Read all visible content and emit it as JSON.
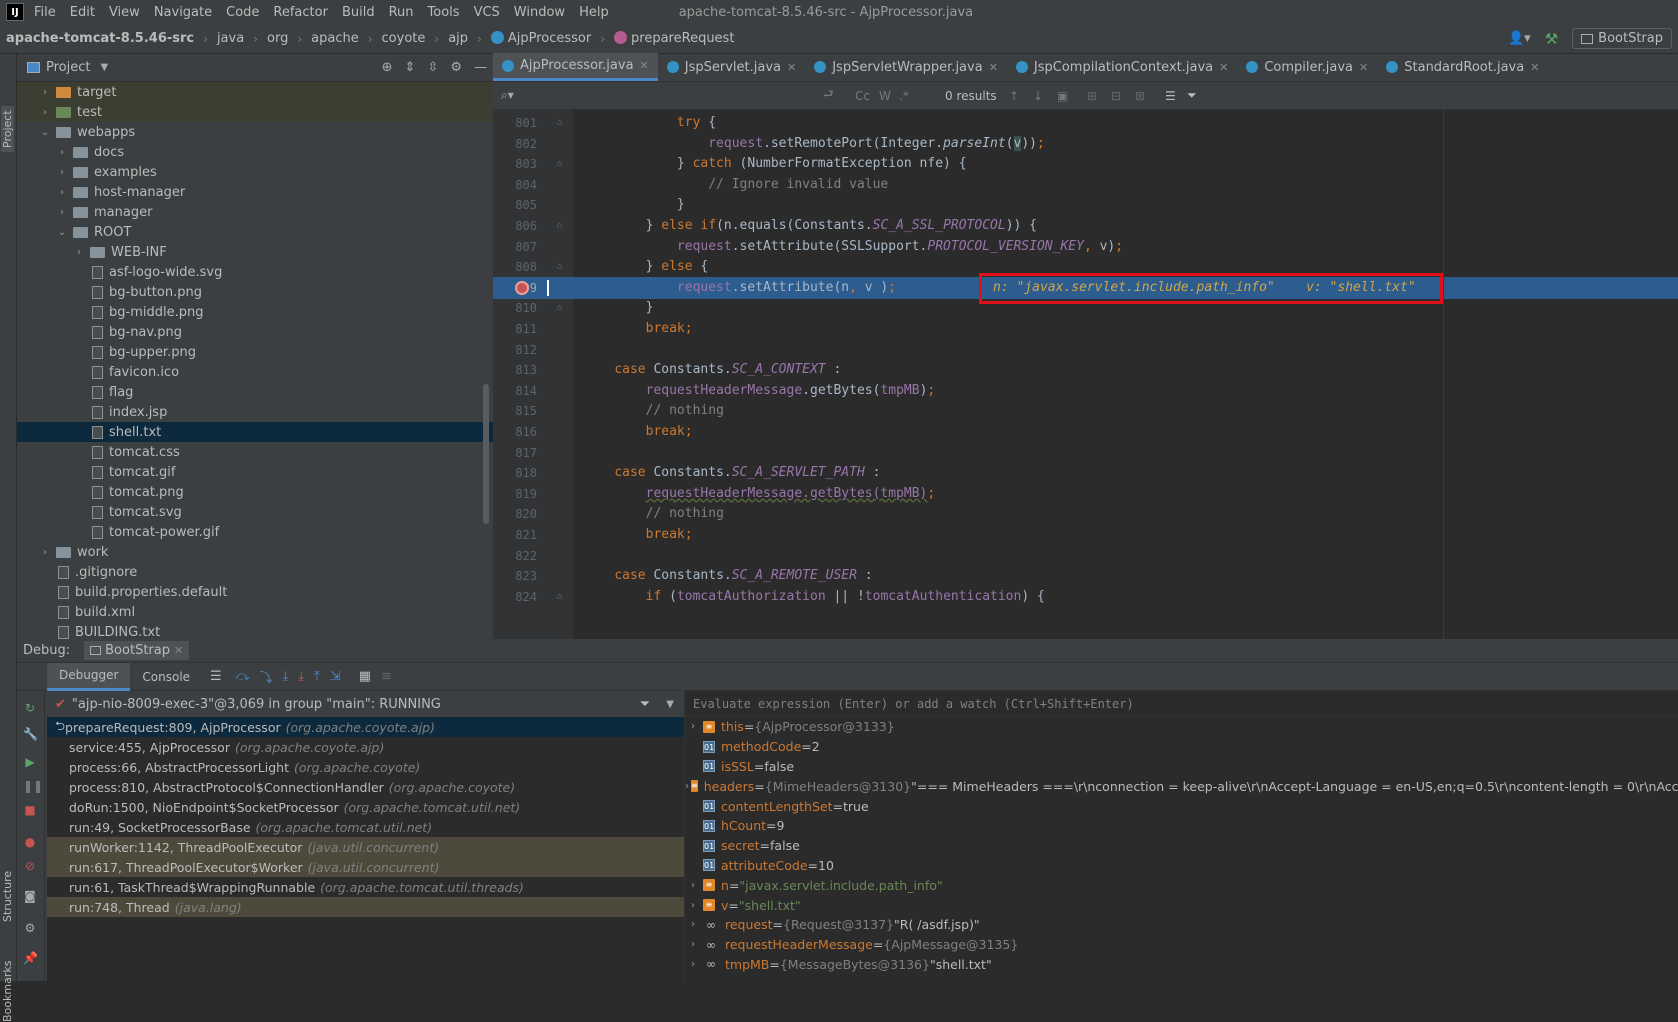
{
  "menubar": {
    "app_icon": "IJ",
    "items": [
      "File",
      "Edit",
      "View",
      "Navigate",
      "Code",
      "Refactor",
      "Build",
      "Run",
      "Tools",
      "VCS",
      "Window",
      "Help"
    ],
    "window_title": "apache-tomcat-8.5.46-src - AjpProcessor.java"
  },
  "breadcrumb": {
    "items": [
      "apache-tomcat-8.5.46-src",
      "java",
      "org",
      "apache",
      "coyote",
      "ajp",
      "AjpProcessor",
      "prepareRequest"
    ]
  },
  "run_config": "BootStrap",
  "left_strip": {
    "project_label": "Project",
    "structure_label": "Structure",
    "bookmarks_label": "Bookmarks"
  },
  "project": {
    "title": "Project",
    "tree": [
      {
        "label": "target",
        "kind": "folder-orange",
        "depth": 1,
        "arrow": "›",
        "style": "excl"
      },
      {
        "label": "test",
        "kind": "folder-green",
        "depth": 1,
        "arrow": "›",
        "style": "excl"
      },
      {
        "label": "webapps",
        "kind": "folder",
        "depth": 1,
        "arrow": "⌄"
      },
      {
        "label": "docs",
        "kind": "folder",
        "depth": 2,
        "arrow": "›"
      },
      {
        "label": "examples",
        "kind": "folder",
        "depth": 2,
        "arrow": "›"
      },
      {
        "label": "host-manager",
        "kind": "folder",
        "depth": 2,
        "arrow": "›"
      },
      {
        "label": "manager",
        "kind": "folder",
        "depth": 2,
        "arrow": "›"
      },
      {
        "label": "ROOT",
        "kind": "folder",
        "depth": 2,
        "arrow": "⌄"
      },
      {
        "label": "WEB-INF",
        "kind": "folder",
        "depth": 3,
        "arrow": "›"
      },
      {
        "label": "asf-logo-wide.svg",
        "kind": "file",
        "depth": 3
      },
      {
        "label": "bg-button.png",
        "kind": "file",
        "depth": 3
      },
      {
        "label": "bg-middle.png",
        "kind": "file",
        "depth": 3
      },
      {
        "label": "bg-nav.png",
        "kind": "file",
        "depth": 3
      },
      {
        "label": "bg-upper.png",
        "kind": "file",
        "depth": 3
      },
      {
        "label": "favicon.ico",
        "kind": "file",
        "depth": 3
      },
      {
        "label": "flag",
        "kind": "file",
        "depth": 3
      },
      {
        "label": "index.jsp",
        "kind": "file",
        "depth": 3
      },
      {
        "label": "shell.txt",
        "kind": "file",
        "depth": 3,
        "style": "sel"
      },
      {
        "label": "tomcat.css",
        "kind": "file",
        "depth": 3
      },
      {
        "label": "tomcat.gif",
        "kind": "file",
        "depth": 3
      },
      {
        "label": "tomcat.png",
        "kind": "file",
        "depth": 3
      },
      {
        "label": "tomcat.svg",
        "kind": "file",
        "depth": 3
      },
      {
        "label": "tomcat-power.gif",
        "kind": "file",
        "depth": 3
      },
      {
        "label": "work",
        "kind": "folder",
        "depth": 1,
        "arrow": "›"
      },
      {
        "label": ".gitignore",
        "kind": "file",
        "depth": 1
      },
      {
        "label": "build.properties.default",
        "kind": "file",
        "depth": 1
      },
      {
        "label": "build.xml",
        "kind": "file",
        "depth": 1
      },
      {
        "label": "BUILDING.txt",
        "kind": "file",
        "depth": 1
      }
    ]
  },
  "editor": {
    "tabs": [
      {
        "label": "AjpProcessor.java",
        "active": true
      },
      {
        "label": "JspServlet.java"
      },
      {
        "label": "JspServletWrapper.java"
      },
      {
        "label": "JspCompilationContext.java"
      },
      {
        "label": "Compiler.java"
      },
      {
        "label": "StandardRoot.java"
      }
    ],
    "find": {
      "results": "0 results",
      "cc": "Cc",
      "w": "W",
      "regex": ".*"
    },
    "lines": [
      {
        "n": "801",
        "html": "            <span class=\"kw\">try</span> {"
      },
      {
        "n": "802",
        "html": "                <span class=\"var\">request</span>.setRemotePort(Integer.<span class=\"ital\">parseInt</span>(<span style=\"background:#3b514d\">v</span>))<span class=\"kw\">;</span>"
      },
      {
        "n": "803",
        "html": "            } <span class=\"kw\">catch</span> (NumberFormatException nfe) {"
      },
      {
        "n": "804",
        "html": "                <span class=\"cmt\">// Ignore invalid value</span>"
      },
      {
        "n": "805",
        "html": "            }"
      },
      {
        "n": "806",
        "html": "        } <span class=\"kw\">else if</span>(n.equals(Constants.<span class=\"cst\">SC_A_SSL_PROTOCOL</span>)) {"
      },
      {
        "n": "807",
        "html": "            <span class=\"var\">request</span>.setAttribute(SSLSupport.<span class=\"cst\">PROTOCOL_VERSION_KEY</span><span class=\"kw\">,</span> v)<span class=\"kw\">;</span>"
      },
      {
        "n": "808",
        "html": "        } <span class=\"kw\">else</span> {"
      },
      {
        "n": "809",
        "html": "            <span class=\"var\">request</span>.setAttribute(n<span class=\"kw\">,</span> v )<span class=\"kw\">;</span>",
        "hl": true
      },
      {
        "n": "810",
        "html": "        }"
      },
      {
        "n": "811",
        "html": "        <span class=\"kw\">break;</span>"
      },
      {
        "n": "812",
        "html": ""
      },
      {
        "n": "813",
        "html": "    <span class=\"kw\">case</span> Constants.<span class=\"cst\">SC_A_CONTEXT</span> :"
      },
      {
        "n": "814",
        "html": "        <span class=\"var\">requestHeaderMessage</span>.getBytes(<span class=\"var\">tmpMB</span>)<span class=\"kw\">;</span>"
      },
      {
        "n": "815",
        "html": "        <span class=\"cmt\">// nothing</span>"
      },
      {
        "n": "816",
        "html": "        <span class=\"kw\">break;</span>"
      },
      {
        "n": "817",
        "html": ""
      },
      {
        "n": "818",
        "html": "    <span class=\"kw\">case</span> Constants.<span class=\"cst\">SC_A_SERVLET_PATH</span> :"
      },
      {
        "n": "819",
        "html": "        <span class=\"var\" style=\"text-decoration:underline wavy #5a6a3a\">requestHeaderMessage.getBytes(tmpMB)</span><span class=\"kw\">;</span>"
      },
      {
        "n": "820",
        "html": "        <span class=\"cmt\">// nothing</span>"
      },
      {
        "n": "821",
        "html": "        <span class=\"kw\">break;</span>"
      },
      {
        "n": "822",
        "html": ""
      },
      {
        "n": "823",
        "html": "    <span class=\"kw\">case</span> Constants.<span class=\"cst\">SC_A_REMOTE_USER</span> :"
      },
      {
        "n": "824",
        "html": "        <span class=\"kw\">if</span> (<span class=\"var\">tomcatAuthorization</span> || !<span class=\"var\">tomcatAuthentication</span>) {"
      }
    ],
    "inline_values": "n: \"javax.servlet.include.path_info\"    v: \"shell.txt\""
  },
  "debug": {
    "title": "Debug:",
    "config_tab": "BootStrap",
    "tabs": [
      "Debugger",
      "Console"
    ],
    "thread": "\"ajp-nio-8009-exec-3\"@3,069 in group \"main\": RUNNING",
    "frames": [
      {
        "method": "prepareRequest:809, AjpProcessor",
        "pkg": "(org.apache.coyote.ajp)",
        "style": "sel"
      },
      {
        "method": "service:455, AjpProcessor",
        "pkg": "(org.apache.coyote.ajp)"
      },
      {
        "method": "process:66, AbstractProcessorLight",
        "pkg": "(org.apache.coyote)"
      },
      {
        "method": "process:810, AbstractProtocol$ConnectionHandler",
        "pkg": "(org.apache.coyote)"
      },
      {
        "method": "doRun:1500, NioEndpoint$SocketProcessor",
        "pkg": "(org.apache.tomcat.util.net)"
      },
      {
        "method": "run:49, SocketProcessorBase",
        "pkg": "(org.apache.tomcat.util.net)"
      },
      {
        "method": "runWorker:1142, ThreadPoolExecutor",
        "pkg": "(java.util.concurrent)",
        "style": "lib"
      },
      {
        "method": "run:617, ThreadPoolExecutor$Worker",
        "pkg": "(java.util.concurrent)",
        "style": "lib"
      },
      {
        "method": "run:61, TaskThread$WrappingRunnable",
        "pkg": "(org.apache.tomcat.util.threads)"
      },
      {
        "method": "run:748, Thread",
        "pkg": "(java.lang)",
        "style": "lib"
      }
    ],
    "eval_placeholder": "Evaluate expression (Enter) or add a watch (Ctrl+Shift+Enter)",
    "variables": [
      {
        "arrow": "›",
        "icon": "fld",
        "name": "this",
        "eq": " = ",
        "type": "{AjpProcessor@3133}",
        "val": ""
      },
      {
        "icon": "prim",
        "name": "methodCode",
        "eq": " = ",
        "type": "",
        "val": "2"
      },
      {
        "icon": "prim",
        "name": "isSSL",
        "eq": " = ",
        "type": "",
        "val": "false"
      },
      {
        "arrow": "›",
        "icon": "fld",
        "name": "headers",
        "eq": " = ",
        "type": "{MimeHeaders@3130}",
        "val": " \"=== MimeHeaders ===\\r\\nconnection = keep-alive\\r\\nAccept-Language = en-US,en;q=0.5\\r\\ncontent-length = 0\\r\\nAccept-Encod"
      },
      {
        "icon": "prim",
        "name": "contentLengthSet",
        "eq": " = ",
        "type": "",
        "val": "true"
      },
      {
        "icon": "prim",
        "name": "hCount",
        "eq": " = ",
        "type": "",
        "val": "9"
      },
      {
        "icon": "prim",
        "name": "secret",
        "eq": " = ",
        "type": "",
        "val": "false"
      },
      {
        "icon": "prim",
        "name": "attributeCode",
        "eq": " = ",
        "type": "",
        "val": "10"
      },
      {
        "arrow": "›",
        "icon": "fld",
        "name": "n",
        "eq": " = ",
        "type": "",
        "val": "\"javax.servlet.include.path_info\"",
        "str": true
      },
      {
        "arrow": "›",
        "icon": "fld",
        "name": "v",
        "eq": " = ",
        "type": "",
        "val": "\"shell.txt\"",
        "str": true
      },
      {
        "arrow": "›",
        "icon": "watch",
        "name": "request",
        "eq": " = ",
        "type": "{Request@3137}",
        "val": " \"R( /asdf.jsp)\""
      },
      {
        "arrow": "›",
        "icon": "watch",
        "name": "requestHeaderMessage",
        "eq": " = ",
        "type": "{AjpMessage@3135}",
        "val": ""
      },
      {
        "arrow": "›",
        "icon": "watch",
        "name": "tmpMB",
        "eq": " = ",
        "type": "{MessageBytes@3136}",
        "val": " \"shell.txt\""
      }
    ]
  },
  "colors": {
    "accent": "#4a88c7",
    "highlight_line": "#2d5d8f",
    "inline_box": "#e0101a",
    "selected_row": "#0d293e"
  }
}
